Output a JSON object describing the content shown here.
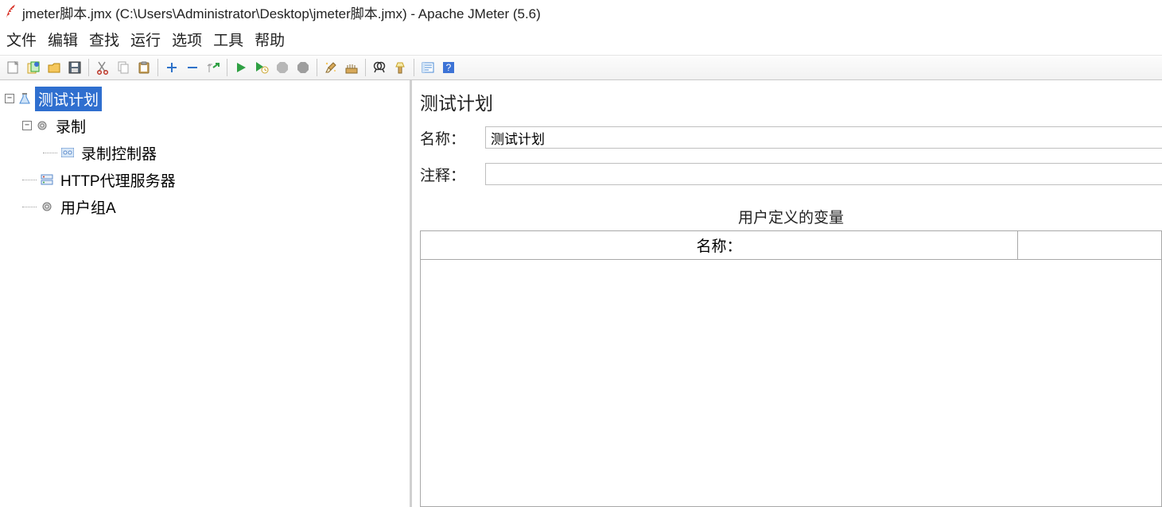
{
  "window": {
    "title": "jmeter脚本.jmx (C:\\Users\\Administrator\\Desktop\\jmeter脚本.jmx) - Apache JMeter (5.6)"
  },
  "menu": {
    "file": "文件",
    "edit": "编辑",
    "search": "查找",
    "run": "运行",
    "options": "选项",
    "tools": "工具",
    "help": "帮助"
  },
  "toolbar": {
    "new": "新建",
    "templates": "模板",
    "open": "打开",
    "save": "保存",
    "cut": "剪切",
    "copy": "复制",
    "paste": "粘贴",
    "add": "添加",
    "remove": "删除",
    "expand": "展开",
    "start": "启动",
    "start_no_pause": "不停顿启动",
    "stop": "停止",
    "shutdown": "关闭",
    "clear": "清除",
    "clear_all": "清除全部",
    "search_btn": "查找",
    "reset_search": "重置查找",
    "fn_help": "函数助手",
    "help_btn": "帮助"
  },
  "tree": {
    "root": {
      "label": "测试计划"
    },
    "recording": {
      "label": "录制"
    },
    "recording_controller": {
      "label": "录制控制器"
    },
    "http_proxy": {
      "label": "HTTP代理服务器"
    },
    "user_group": {
      "label": "用户组A"
    }
  },
  "panel": {
    "title": "测试计划",
    "name_label": "名称：",
    "name_value": "测试计划",
    "comment_label": "注释：",
    "comment_value": "",
    "vars_title": "用户定义的变量",
    "vars_col_name": "名称："
  }
}
